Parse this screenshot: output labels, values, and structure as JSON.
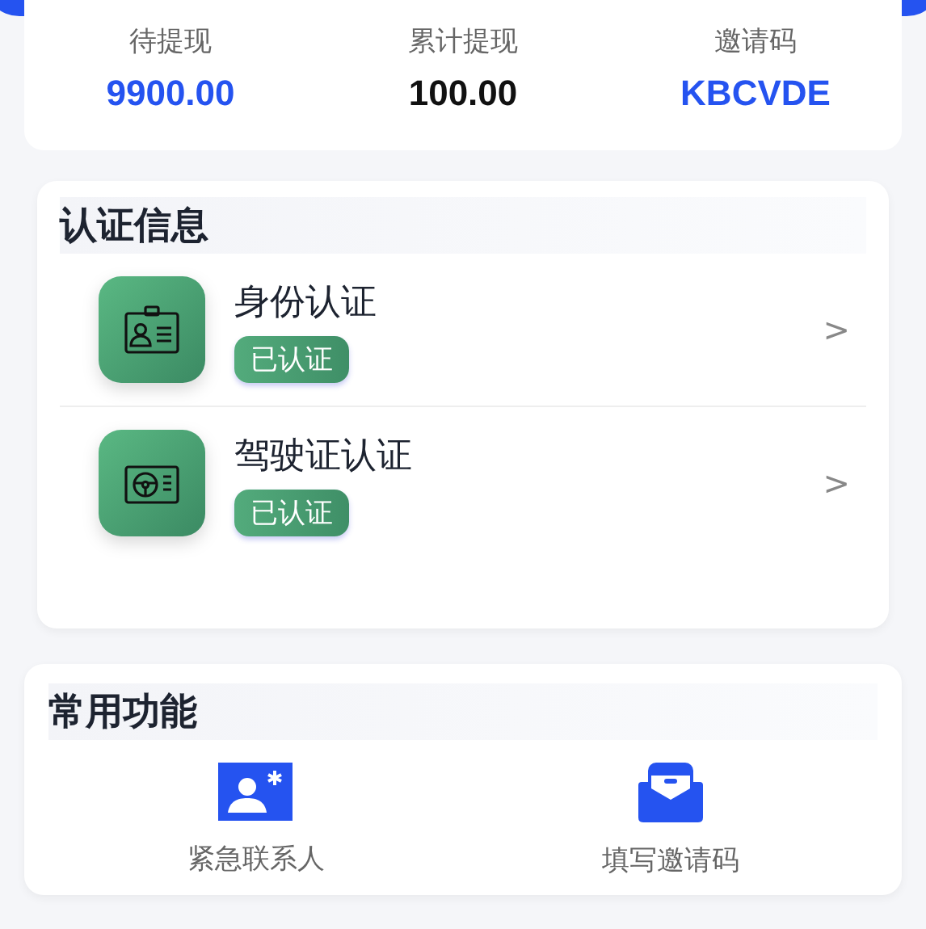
{
  "stats": [
    {
      "label": "待提现",
      "value": "9900.00",
      "color": "#2553f0"
    },
    {
      "label": "累计提现",
      "value": "100.00",
      "color": "#111111"
    },
    {
      "label": "邀请码",
      "value": "KBCVDE",
      "color": "#2553f0"
    }
  ],
  "verification": {
    "title": "认证信息",
    "items": [
      {
        "kind": "id-card",
        "name": "身份认证",
        "status": "已认证",
        "chevron": ">"
      },
      {
        "kind": "license",
        "name": "驾驶证认证",
        "status": "已认证",
        "chevron": ">"
      }
    ]
  },
  "functions": {
    "title": "常用功能",
    "items": [
      {
        "kind": "contact",
        "label": "紧急联系人"
      },
      {
        "kind": "invite",
        "label": "填写邀请码"
      }
    ]
  }
}
